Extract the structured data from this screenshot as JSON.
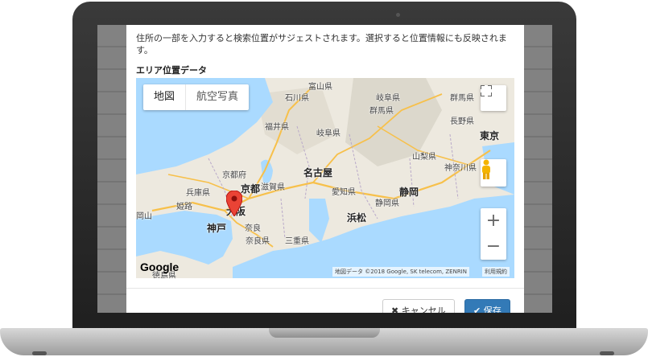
{
  "dialog": {
    "help_text": "住所の一部を入力すると検索位置がサジェストされます。選択すると位置情報にも反映されます。",
    "area_label": "エリア位置データ",
    "cancel_label": "キャンセル",
    "save_label": "保存"
  },
  "map": {
    "type_map": "地図",
    "type_satellite": "航空写真",
    "places": {
      "toyama": "富山県",
      "ishikawa": "石川県",
      "gifu_top": "岐阜県",
      "gunma": "群馬県",
      "fukui": "福井県",
      "gifu": "岐阜県",
      "nagano": "長野県",
      "tokyo": "東京",
      "yamanashi": "山梨県",
      "kanagawa": "神奈川県",
      "kyotofu": "京都府",
      "nagoya": "名古屋",
      "hyogo": "兵庫県",
      "kyoto": "京都",
      "shiga": "滋賀県",
      "aichi": "愛知県",
      "shizuoka": "静岡",
      "shizuoka_pref": "静岡県",
      "himeji": "姫路",
      "osaka": "大阪",
      "hamamatsu": "浜松",
      "okayama": "岡山",
      "kobe": "神戸",
      "nara_city": "奈良",
      "nara": "奈良県",
      "mie": "三重県",
      "tokushima": "徳島県"
    },
    "google_logo": "Google",
    "attribution": "地図データ ©2018 Google, SK telecom, ZENRIN",
    "terms": "利用規約",
    "colors": {
      "water": "#aadaff",
      "land": "#ede9df",
      "highway": "#f7c04a",
      "marker": "#ea4335"
    }
  },
  "icons": {
    "fullscreen": "fullscreen-icon",
    "pegman": "pegman-icon",
    "zoom_in": "zoom-in-icon",
    "zoom_out": "zoom-out-icon",
    "cancel": "close-icon",
    "save": "check-icon",
    "marker": "map-marker-icon"
  }
}
